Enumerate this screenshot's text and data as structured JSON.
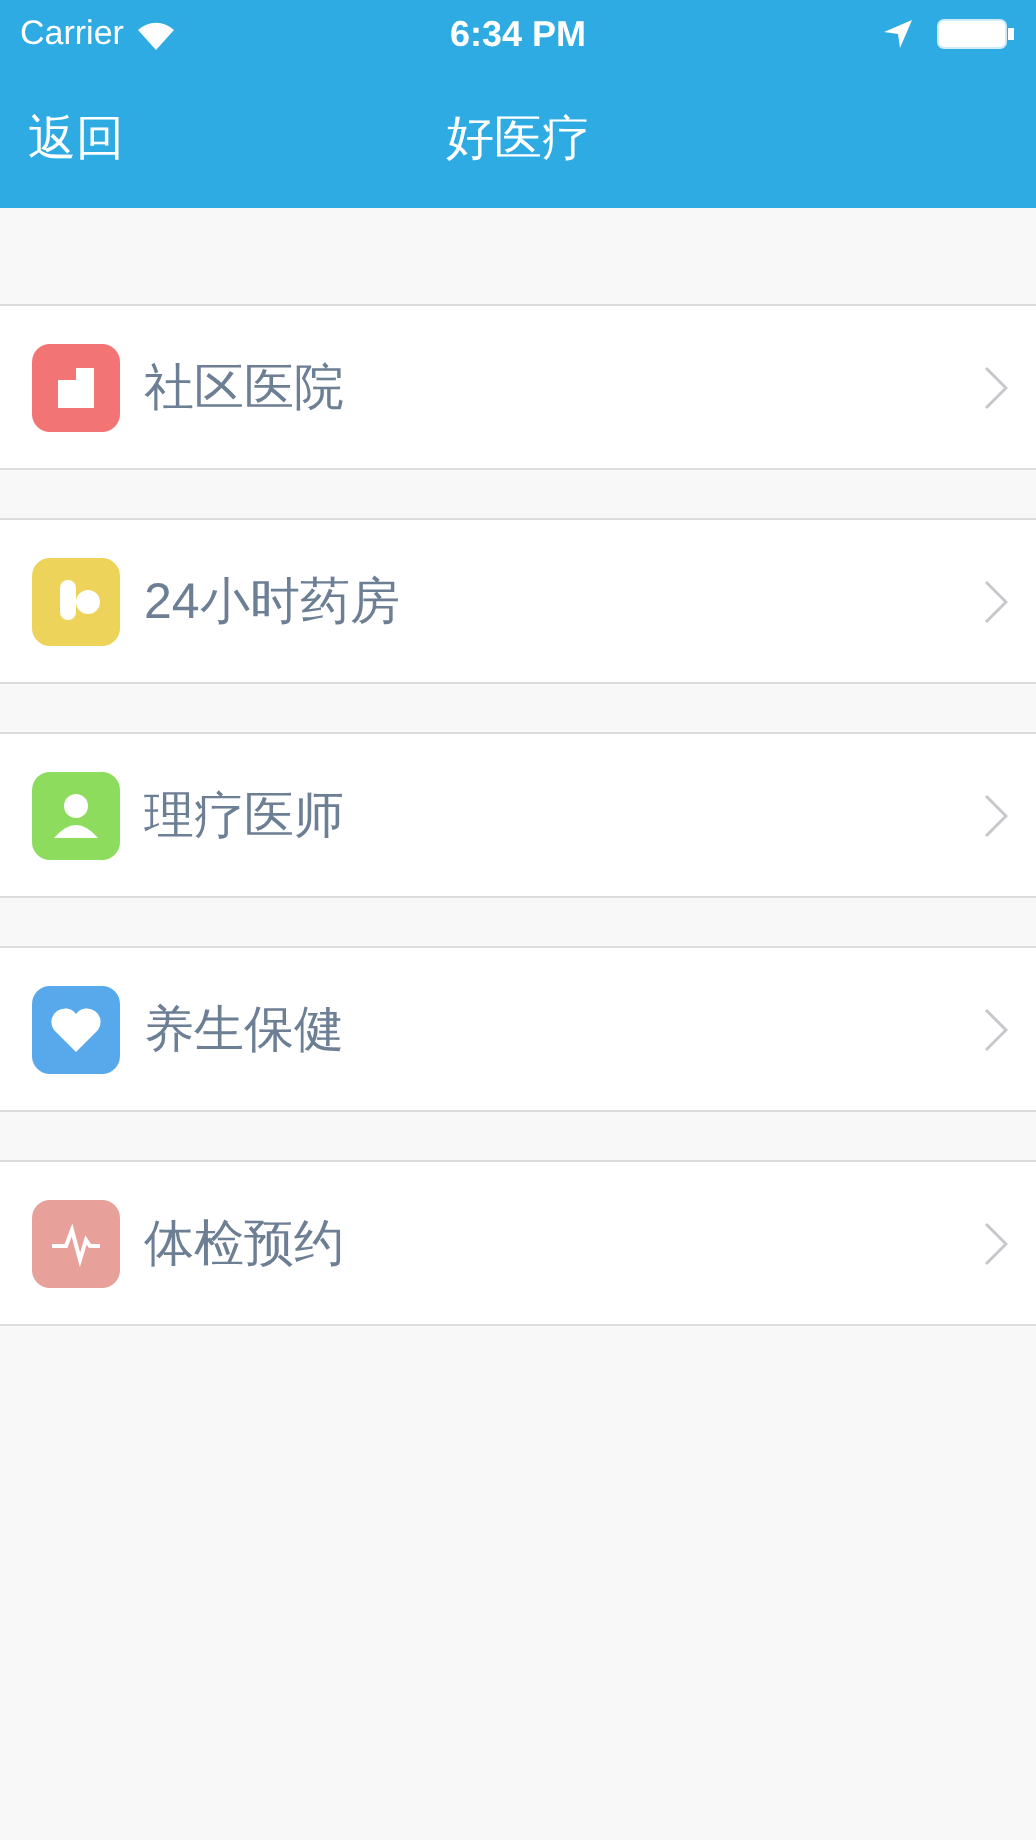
{
  "status_bar": {
    "carrier": "Carrier",
    "time": "6:34 PM"
  },
  "nav_bar": {
    "back": "返回",
    "title": "好医疗"
  },
  "menu": [
    {
      "label": "社区医院",
      "color": "#f27474"
    },
    {
      "label": "24小时药房",
      "color": "#edd35a"
    },
    {
      "label": "理疗医师",
      "color": "#8ddc5e"
    },
    {
      "label": "养生保健",
      "color": "#57a9ec"
    },
    {
      "label": "体检预约",
      "color": "#e8a09b"
    }
  ]
}
